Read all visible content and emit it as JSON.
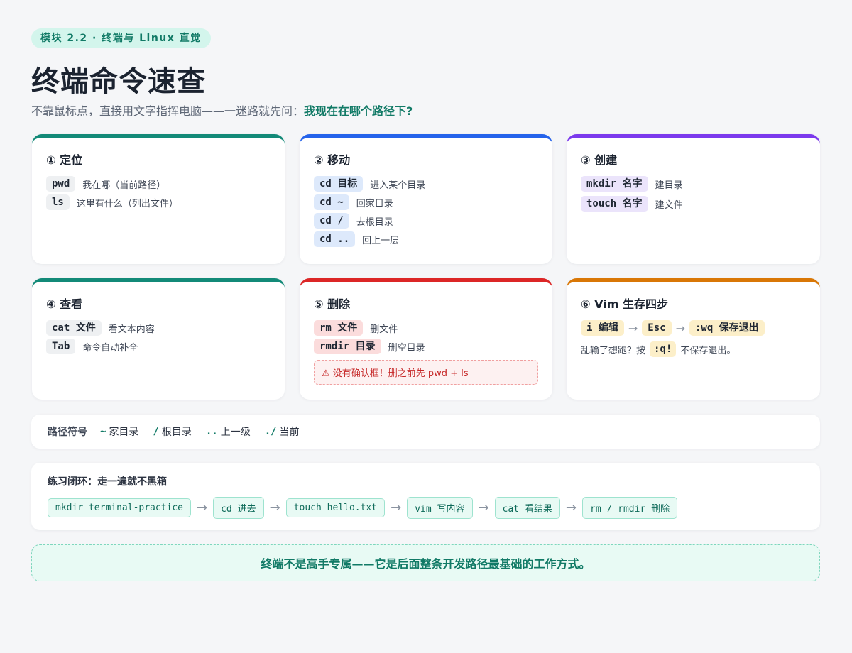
{
  "colors": {
    "accent": "#138a78",
    "card1": "#138a78",
    "card2": "#2563eb",
    "card3": "#7c3aed",
    "card4": "#138a78",
    "card5": "#dc2626",
    "card6": "#d97706"
  },
  "badge": "模块 2.2 · 终端与 Linux 直觉",
  "title": "终端命令速查",
  "subtitle": {
    "text": "不靠鼠标点，直接用文字指挥电脑——一迷路就先问：",
    "highlight": "我现在在哪个路径下?"
  },
  "cards": [
    {
      "title": "① 定位",
      "rows": [
        {
          "code": "pwd",
          "desc": "我在哪（当前路径）"
        },
        {
          "code": "ls",
          "desc": "这里有什么（列出文件）"
        }
      ]
    },
    {
      "title": "② 移动",
      "rows": [
        {
          "code": "cd 目标",
          "desc": "进入某个目录"
        },
        {
          "code": "cd ~",
          "desc": "回家目录"
        },
        {
          "code": "cd /",
          "desc": "去根目录"
        },
        {
          "code": "cd ..",
          "desc": "回上一层"
        }
      ]
    },
    {
      "title": "③ 创建",
      "rows": [
        {
          "code": "mkdir 名字",
          "desc": "建目录"
        },
        {
          "code": "touch 名字",
          "desc": "建文件"
        }
      ]
    },
    {
      "title": "④ 查看",
      "rows": [
        {
          "code": "cat 文件",
          "desc": "看文本内容"
        },
        {
          "code": "Tab",
          "desc": "命令自动补全"
        }
      ]
    },
    {
      "title": "⑤ 删除",
      "rows": [
        {
          "code": "rm 文件",
          "desc": "删文件"
        },
        {
          "code": "rmdir 目录",
          "desc": "删空目录"
        }
      ],
      "warning": "⚠ 没有确认框！删之前先 pwd + ls"
    },
    {
      "title": "⑥ Vim 生存四步",
      "keys": [
        "i 编辑",
        "Esc",
        ":wq 保存退出"
      ],
      "note_prefix": "乱输了想跑？按",
      "note_key": ":q!",
      "note_suffix": "不保存退出。"
    }
  ],
  "path_symbols": {
    "label": "路径符号",
    "items": [
      {
        "sym": "~",
        "text": "家目录"
      },
      {
        "sym": "/",
        "text": "根目录"
      },
      {
        "sym": "..",
        "text": "上一级"
      },
      {
        "sym": "./",
        "text": "当前"
      }
    ]
  },
  "practice": {
    "label": "练习闭环：走一遍就不黑箱",
    "steps": [
      "mkdir terminal-practice",
      "cd 进去",
      "touch hello.txt",
      "vim 写内容",
      "cat 看结果",
      "rm / rmdir 删除"
    ],
    "arrow": "→"
  },
  "footer": "终端不是高手专属——它是后面整条开发路径最基础的工作方式。"
}
